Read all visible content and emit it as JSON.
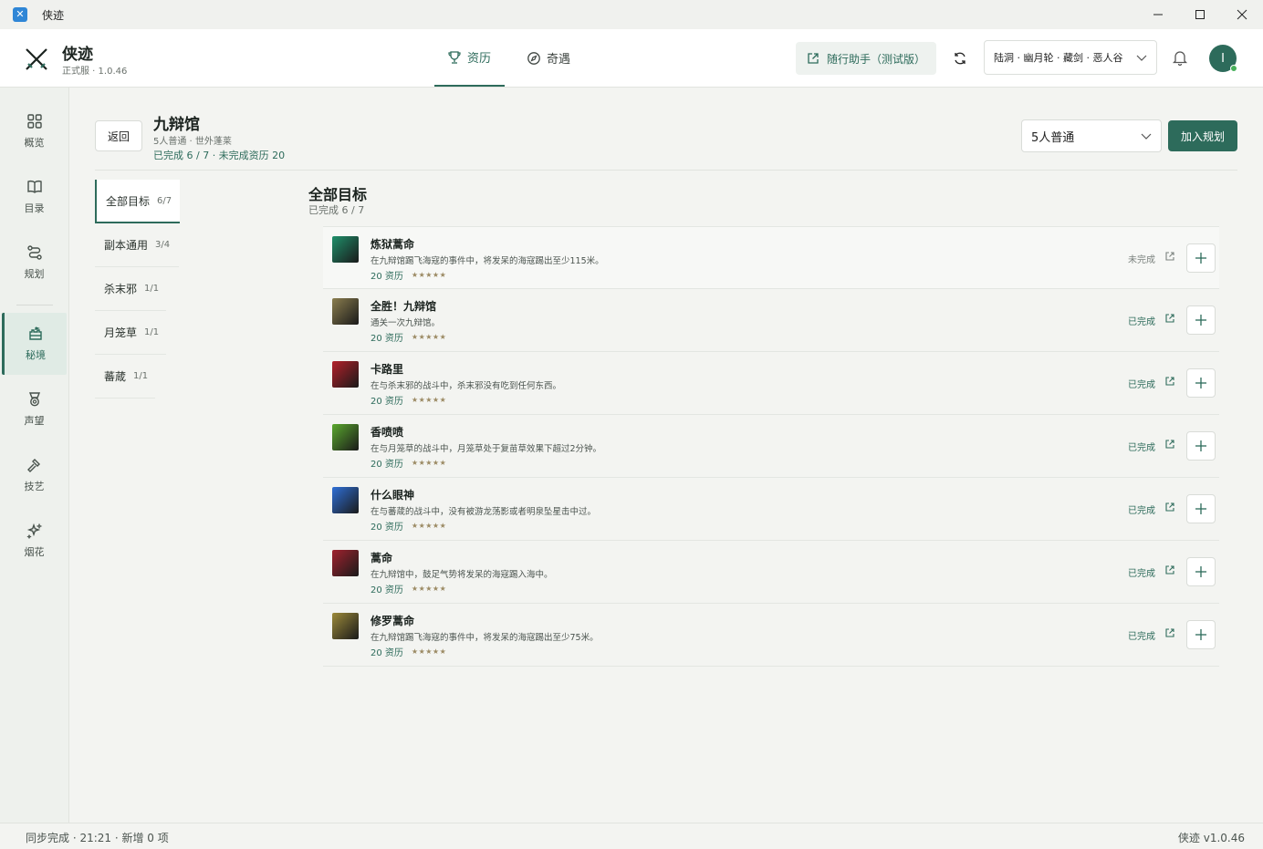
{
  "window": {
    "title": "侠迹"
  },
  "header": {
    "brand_name": "侠迹",
    "brand_version": "正式服 · 1.0.46",
    "tabs": [
      {
        "label": "资历",
        "icon": "trophy-icon",
        "active": true
      },
      {
        "label": "奇遇",
        "icon": "compass-icon",
        "active": false
      }
    ],
    "assistant_label": "随行助手（测试版）",
    "character": "陆洞 · 幽月轮 · 藏剑 · 恶人谷",
    "avatar_letter": "I"
  },
  "sidebar": {
    "items": [
      {
        "label": "概览",
        "icon": "grid-icon"
      },
      {
        "label": "目录",
        "icon": "book-icon"
      },
      {
        "label": "规划",
        "icon": "route-icon"
      },
      {
        "label": "秘境",
        "icon": "castle-icon",
        "active": true
      },
      {
        "label": "声望",
        "icon": "medal-icon"
      },
      {
        "label": "技艺",
        "icon": "hammer-icon"
      },
      {
        "label": "烟花",
        "icon": "sparkle-icon"
      }
    ]
  },
  "dungeon": {
    "back_label": "返回",
    "title": "九辩馆",
    "subtitle": "5人普通 · 世外蓬莱",
    "progress": "已完成 6 / 7 · 未完成资历 20",
    "mode": "5人普通",
    "add_plan_label": "加入规划"
  },
  "filters": [
    {
      "label": "全部目标",
      "count": "6/7",
      "active": true
    },
    {
      "label": "副本通用",
      "count": "3/4"
    },
    {
      "label": "杀末邪",
      "count": "1/1"
    },
    {
      "label": "月笼草",
      "count": "1/1"
    },
    {
      "label": "蕃葴",
      "count": "1/1"
    }
  ],
  "list": {
    "title": "全部目标",
    "subtitle": "已完成 6 / 7",
    "achievements": [
      {
        "name": "炼狱蒿命",
        "desc": "在九辩馆踢飞海寇的事件中，将发呆的海寇踢出至少115米。",
        "reward": "20 资历",
        "stars": "★★★★★",
        "status": "未完成",
        "icon_color": "#1f8f6a",
        "done": false
      },
      {
        "name": "全胜！九辩馆",
        "desc": "通关一次九辩馆。",
        "reward": "20 资历",
        "stars": "★★★★★",
        "status": "已完成",
        "icon_color": "#8a7d4e",
        "done": true
      },
      {
        "name": "卡路里",
        "desc": "在与杀末邪的战斗中，杀末邪没有吃到任何东西。",
        "reward": "20 资历",
        "stars": "★★★★★",
        "status": "已完成",
        "icon_color": "#b3202a",
        "done": true
      },
      {
        "name": "香喷喷",
        "desc": "在与月笼草的战斗中，月笼草处于复苗草效果下超过2分钟。",
        "reward": "20 资历",
        "stars": "★★★★★",
        "status": "已完成",
        "icon_color": "#5aa82e",
        "done": true
      },
      {
        "name": "什么眼神",
        "desc": "在与蕃葴的战斗中，没有被游龙荡影或者明泉坠星击中过。",
        "reward": "20 资历",
        "stars": "★★★★★",
        "status": "已完成",
        "icon_color": "#2f6fd6",
        "done": true
      },
      {
        "name": "蒿命",
        "desc": "在九辩馆中，鼓足气势将发呆的海寇踢入海中。",
        "reward": "20 资历",
        "stars": "★★★★★",
        "status": "已完成",
        "icon_color": "#a0222e",
        "done": true
      },
      {
        "name": "修罗蒿命",
        "desc": "在九辩馆踢飞海寇的事件中，将发呆的海寇踢出至少75米。",
        "reward": "20 资历",
        "stars": "★★★★★",
        "status": "已完成",
        "icon_color": "#9c8a3a",
        "done": true
      }
    ]
  },
  "footer": {
    "status": "同步完成 · 21:21 · 新增 0 项",
    "version": "侠迹 v1.0.46"
  },
  "colors": {
    "accent": "#2d6b5b",
    "background": "#f3f4f1"
  }
}
